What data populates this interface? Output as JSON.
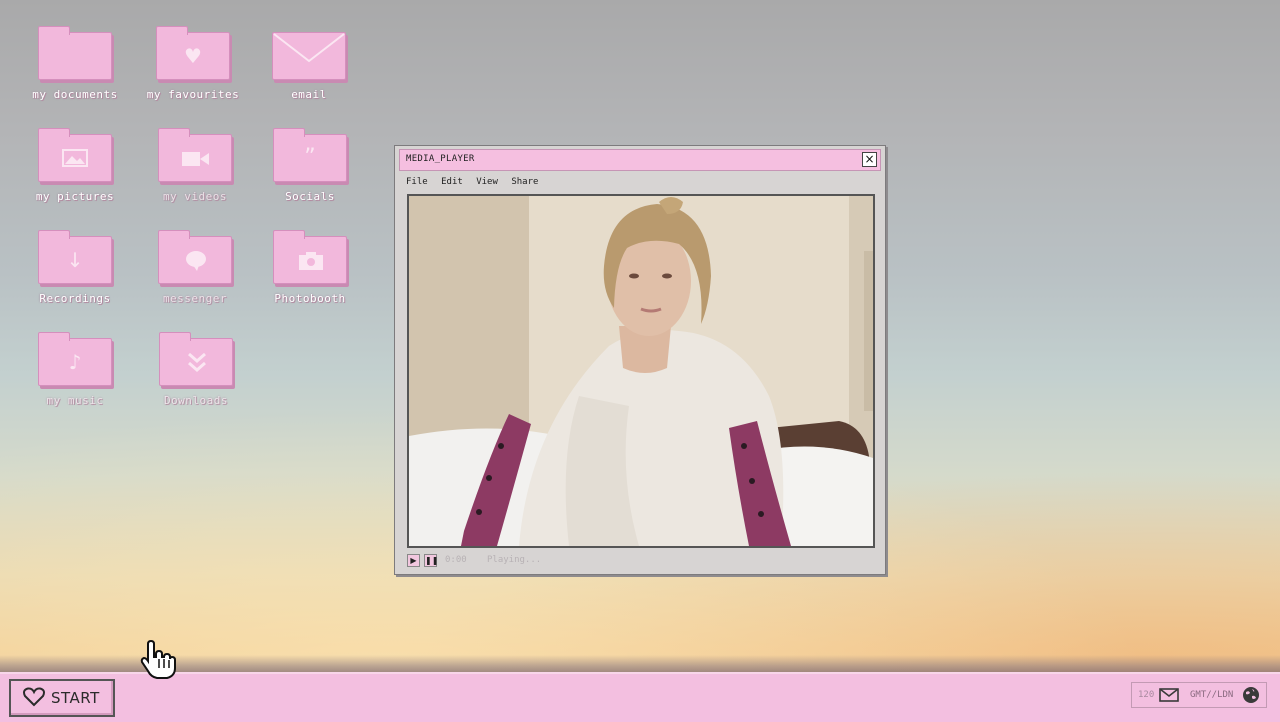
{
  "desktop": {
    "icons": [
      {
        "label": "my documents",
        "icon": "folder-icon"
      },
      {
        "label": "my favourites",
        "icon": "heart-folder-icon"
      },
      {
        "label": "email",
        "icon": "envelope-icon"
      },
      {
        "label": "my pictures",
        "icon": "picture-folder-icon"
      },
      {
        "label": "my videos",
        "icon": "video-camera-folder-icon"
      },
      {
        "label": "Socials",
        "icon": "quote-folder-icon"
      },
      {
        "label": "Recordings",
        "icon": "download-arrow-folder-icon"
      },
      {
        "label": "messenger",
        "icon": "speech-bubble-folder-icon"
      },
      {
        "label": "Photobooth",
        "icon": "camera-folder-icon"
      },
      {
        "label": "my music",
        "icon": "music-note-folder-icon"
      },
      {
        "label": "Downloads",
        "icon": "double-chevron-folder-icon"
      }
    ]
  },
  "media_player": {
    "title": "MEDIA_PLAYER",
    "menu": [
      "File",
      "Edit",
      "View",
      "Share"
    ],
    "time": "0:00",
    "status": "Playing..."
  },
  "taskbar": {
    "start_label": "START",
    "tray_count": "120",
    "timezone": "GMT//LDN"
  },
  "colors": {
    "accent_pink": "#f3bfe0",
    "folder_pink": "#f2b8dc"
  }
}
